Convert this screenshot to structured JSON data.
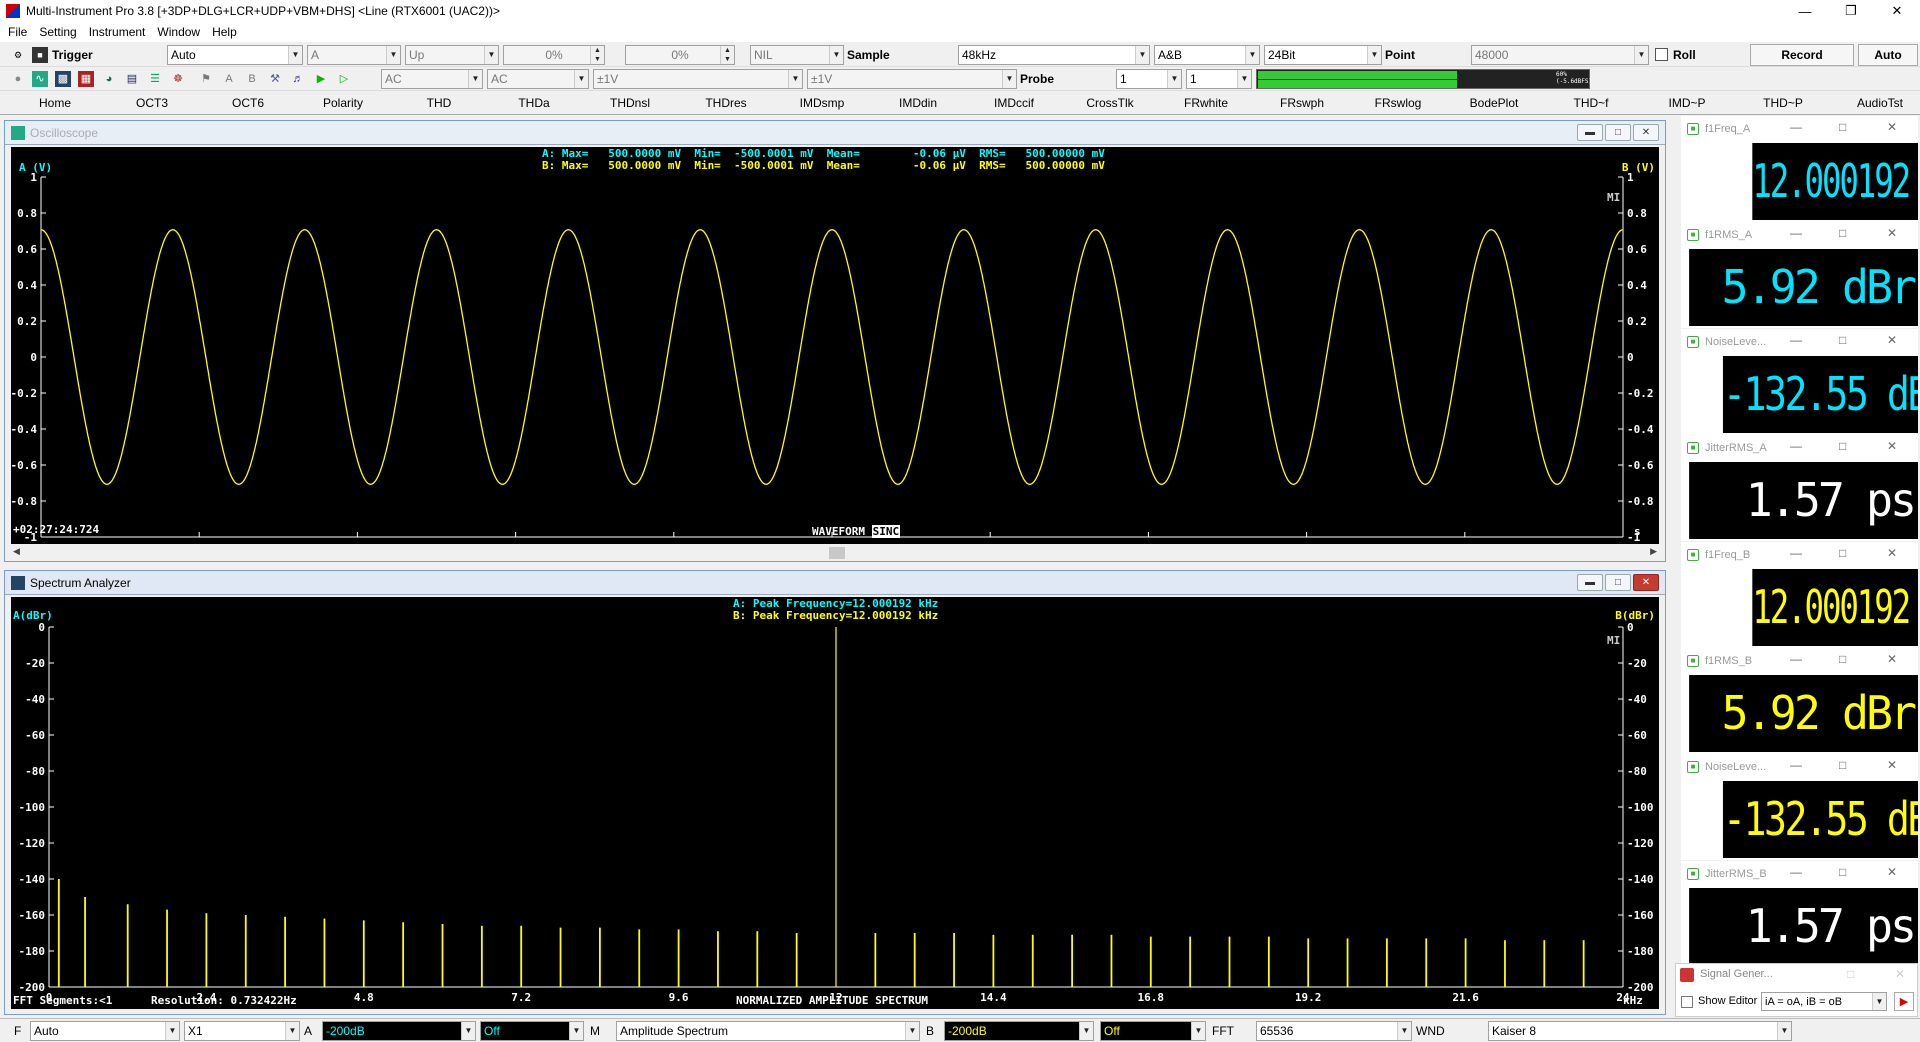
{
  "window": {
    "title": "Multi-Instrument Pro 3.8   [+3DP+DLG+LCR+UDP+VBM+DHS]   <Line (RTX6001 (UAC2))>"
  },
  "menu": [
    "File",
    "Setting",
    "Instrument",
    "Window",
    "Help"
  ],
  "toolbar1": {
    "trigger_label": "Trigger",
    "trigger_mode": "Auto",
    "channel": "A",
    "edge": "Up",
    "level_pct": "0%",
    "pos_pct": "0%",
    "nil": "NIL",
    "sample_label": "Sample",
    "sample_rate": "48kHz",
    "channels": "A&B",
    "bits": "24Bit",
    "point_label": "Point",
    "points": "48000",
    "roll_label": "Roll",
    "record_label": "Record",
    "auto_label": "Auto"
  },
  "toolbar2": {
    "coupling_a": "AC",
    "coupling_b": "AC",
    "range_a": "±1V",
    "range_b": "±1V",
    "probe_label": "Probe",
    "probe_a": "1",
    "probe_b": "1",
    "level_readout": "60%(-5.6dBFS)",
    "level_fraction": 0.6
  },
  "tabs": [
    "Home",
    "OCT3",
    "OCT6",
    "Polarity",
    "THD",
    "THDa",
    "THDnsl",
    "THDres",
    "IMDsmp",
    "IMDdin",
    "IMDccif",
    "CrossTlk",
    "FRwhite",
    "FRswph",
    "FRswlog",
    "BodePlot",
    "THD~f",
    "IMD~P",
    "THD~P",
    "AudioTst"
  ],
  "oscilloscope": {
    "title": "Oscilloscope",
    "ylabel_a": "A (V)",
    "ylabel_b": "B (V)",
    "stats_a": "A: Max=   500.0000 mV  Min=  -500.0001 mV  Mean=        -0.06 μV  RMS=   500.00000 mV",
    "stats_b": "B: Max=   500.0000 mV  Min=  -500.0001 mV  Mean=        -0.06 μV  RMS=   500.00000 mV",
    "timestamp": "+02:27:24:724",
    "bottom_label": "WAVEFORM",
    "sinc_label": "SINC",
    "x_unit": "s",
    "mi": "MI"
  },
  "spectrum": {
    "title": "Spectrum Analyzer",
    "ylabel_a": "A(dBr)",
    "ylabel_b": "B(dBr)",
    "peak_a": "A: Peak Frequency=12.000192 kHz",
    "peak_b": "B: Peak Frequency=12.000192 kHz",
    "fft_segments": "FFT Segments:<1",
    "resolution": "Resolution: 0.732422Hz",
    "bottom_label": "NORMALIZED AMPLITUDE SPECTRUM",
    "x_unit": "kHz",
    "mi": "MI"
  },
  "meters": [
    {
      "title": "f1Freq_A",
      "value": "12.000192 kHz",
      "color": "#00e5ff"
    },
    {
      "title": "f1RMS_A",
      "value": "5.92 dBr",
      "color": "#00e5ff"
    },
    {
      "title": "NoiseLeve...",
      "value": "-132.55 dBr",
      "color": "#00e5ff"
    },
    {
      "title": "JitterRMS_A",
      "value": "1.57 ps",
      "color": "#ffffff"
    },
    {
      "title": "f1Freq_B",
      "value": "12.000192 kHz",
      "color": "#ffff00"
    },
    {
      "title": "f1RMS_B",
      "value": "5.92 dBr",
      "color": "#ffff00"
    },
    {
      "title": "NoiseLeve...",
      "value": "-132.55 dBr",
      "color": "#ffff00"
    },
    {
      "title": "JitterRMS_B",
      "value": "1.57 ps",
      "color": "#ffffff"
    }
  ],
  "siggen": {
    "title": "Signal Gener...",
    "show_editor": "Show Editor",
    "mode": "iA = oA, iB = oB"
  },
  "statusbar": {
    "f_label": "F",
    "f_value": "Auto",
    "x_value": "X1",
    "a_label": "A",
    "a_value": "-200dB",
    "a_off": "Off",
    "m_label": "M",
    "m_value": "Amplitude Spectrum",
    "b_label": "B",
    "b_value": "-200dB",
    "b_off": "Off",
    "fft_label": "FFT",
    "fft_value": "65536",
    "wnd_label": "WND",
    "wnd_value": "Kaiser 8"
  },
  "chart_data": [
    {
      "type": "line",
      "title": "",
      "xlabel": "s",
      "ylabel": "A (V)",
      "xlim": [
        0.4995,
        0.5005
      ],
      "ylim": [
        -1,
        1
      ],
      "x_ticks": [
        "0.4995",
        "0.4996",
        "0.4997",
        "0.4998",
        "0.4999",
        "0.5",
        "0.5001",
        "0.5002",
        "0.5003",
        "0.5004",
        "0.5005"
      ],
      "y_ticks": [
        "1",
        "0.8",
        "0.6",
        "0.4",
        "0.2",
        "0",
        "-0.2",
        "-0.4",
        "-0.6",
        "-0.8",
        "-1"
      ],
      "series": [
        {
          "name": "A",
          "color": "#ffff00",
          "frequency_hz": 12000.192,
          "amplitude": 0.7071,
          "phase_at_0.5s": 0
        }
      ],
      "grid": false
    },
    {
      "type": "bar",
      "title": "",
      "xlabel": "kHz",
      "ylabel": "A(dBr)",
      "xlim": [
        0,
        24
      ],
      "ylim": [
        -200,
        0
      ],
      "x_ticks": [
        "0",
        "2.4",
        "4.8",
        "7.2",
        "9.6",
        "12",
        "14.4",
        "16.8",
        "19.2",
        "21.6",
        "24"
      ],
      "y_ticks": [
        "0",
        "-20",
        "-40",
        "-60",
        "-80",
        "-100",
        "-120",
        "-140",
        "-160",
        "-180",
        "-200"
      ],
      "series": [
        {
          "name": "A",
          "color": "#ffff00",
          "x": [
            0.15,
            0.55,
            1.2,
            1.8,
            2.4,
            3.0,
            3.6,
            4.2,
            4.8,
            5.4,
            6.0,
            6.6,
            7.2,
            7.8,
            8.4,
            9.0,
            9.6,
            10.2,
            10.8,
            11.4,
            12.0,
            12.6,
            13.2,
            13.8,
            14.4,
            15.0,
            15.6,
            16.2,
            16.8,
            17.4,
            18.0,
            18.6,
            19.2,
            19.8,
            20.4,
            21.0,
            21.6,
            22.2,
            22.8,
            23.4
          ],
          "values": [
            -140,
            -150,
            -154,
            -157,
            -159,
            -160,
            -161,
            -162,
            -163,
            -164,
            -165,
            -166,
            -166,
            -167,
            -167,
            -168,
            -168,
            -169,
            -169,
            -170,
            0,
            -170,
            -170,
            -170,
            -171,
            -171,
            -171,
            -171,
            -172,
            -172,
            -172,
            -172,
            -173,
            -173,
            -173,
            -173,
            -173,
            -174,
            -174,
            -174
          ]
        }
      ],
      "grid": false
    }
  ]
}
